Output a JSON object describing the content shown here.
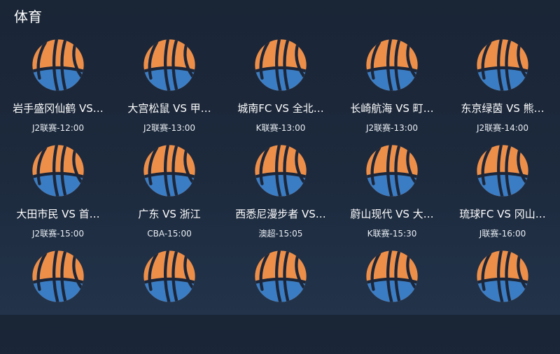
{
  "header": {
    "title": "体育"
  },
  "colors": {
    "ball_top": "#ee8f49",
    "ball_bottom": "#3b7dc4",
    "seam": "#1c2638"
  },
  "matches": [
    {
      "title": "岩手盛冈仙鹤  VS…",
      "info": "J2联赛-12:00",
      "icon": "basketball-icon"
    },
    {
      "title": "大宫松鼠  VS  甲…",
      "info": "J2联赛-13:00",
      "icon": "basketball-icon"
    },
    {
      "title": "城南FC  VS  全北…",
      "info": "K联赛-13:00",
      "icon": "basketball-icon"
    },
    {
      "title": "长崎航海  VS  町…",
      "info": "J2联赛-13:00",
      "icon": "basketball-icon"
    },
    {
      "title": "东京绿茵  VS  熊…",
      "info": "J2联赛-14:00",
      "icon": "basketball-icon"
    },
    {
      "title": "大田市民  VS  首…",
      "info": "J2联赛-15:00",
      "icon": "basketball-icon"
    },
    {
      "title": "广东  VS  浙江",
      "info": "CBA-15:00",
      "icon": "basketball-icon"
    },
    {
      "title": "西悉尼漫步者  VS…",
      "info": "澳超-15:05",
      "icon": "basketball-icon"
    },
    {
      "title": "蔚山现代  VS  大…",
      "info": "K联赛-15:30",
      "icon": "basketball-icon"
    },
    {
      "title": "琉球FC  VS  冈山…",
      "info": "J联赛-16:00",
      "icon": "basketball-icon"
    },
    {
      "title": "",
      "info": "",
      "icon": "basketball-icon"
    },
    {
      "title": "",
      "info": "",
      "icon": "basketball-icon"
    },
    {
      "title": "",
      "info": "",
      "icon": "basketball-icon"
    },
    {
      "title": "",
      "info": "",
      "icon": "basketball-icon"
    },
    {
      "title": "",
      "info": "",
      "icon": "basketball-icon"
    }
  ]
}
